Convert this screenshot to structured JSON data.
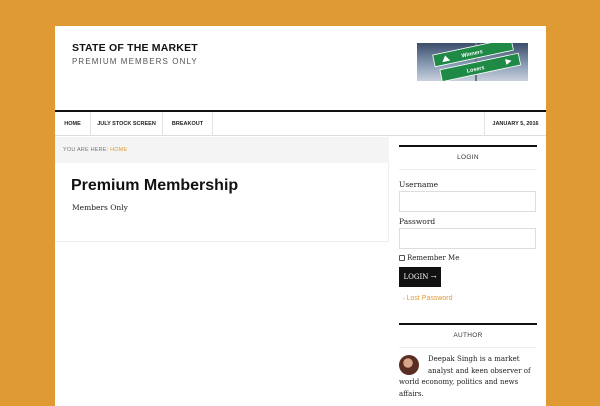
{
  "header": {
    "site_title": "STATE OF THE MARKET",
    "site_description": "PREMIUM MEMBERS ONLY",
    "banner": {
      "winners": "Winners",
      "losers": "Losers"
    }
  },
  "nav": {
    "items": [
      {
        "label": "HOME"
      },
      {
        "label": "JULY STOCK SCREEN"
      },
      {
        "label": "BREAKOUT"
      }
    ],
    "date": "JANUARY 5, 2016"
  },
  "breadcrumb": {
    "prefix": "YOU ARE HERE:",
    "current": "HOME"
  },
  "entry": {
    "title": "Premium Membership",
    "body": "Members Only"
  },
  "login_widget": {
    "title": "LOGIN",
    "username_label": "Username",
    "password_label": "Password",
    "remember_label": "Remember Me",
    "login_button": "LOGIN →",
    "lost_password": "Lost Password"
  },
  "author_widget": {
    "title": "AUTHOR",
    "bio": "Deepak Singh is a market analyst and keen observer of world economy, politics and news affairs."
  },
  "colors": {
    "background": "#df9a34",
    "accent": "#df9a34",
    "nav_border": "#111111",
    "sign_green": "#1e8a45"
  }
}
